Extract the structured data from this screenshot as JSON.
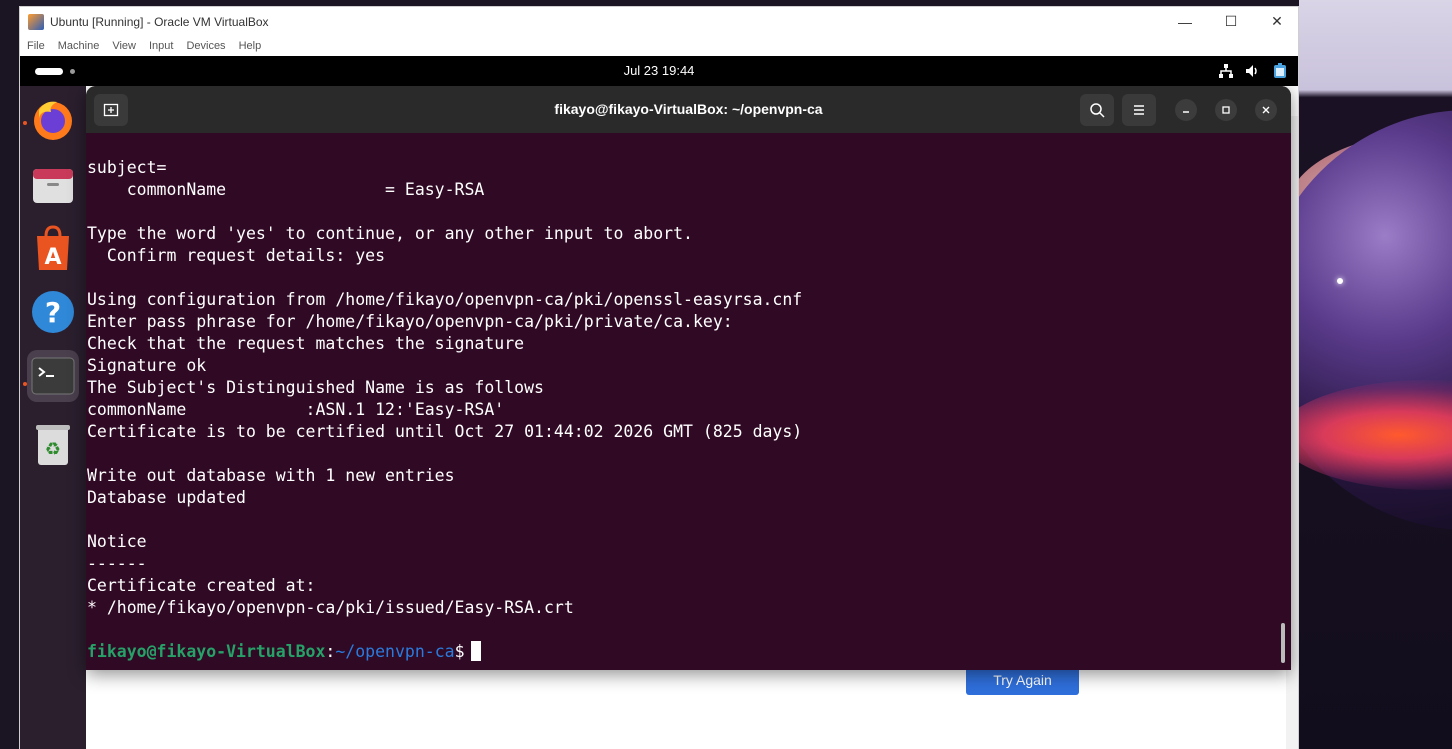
{
  "host": {
    "window_title": "Ubuntu [Running] - Oracle VM VirtualBox",
    "menu": [
      "File",
      "Machine",
      "View",
      "Input",
      "Devices",
      "Help"
    ],
    "controls": {
      "minimize": "—",
      "maximize": "☐",
      "close": "✕"
    }
  },
  "guest": {
    "clock": "Jul 23  19:44",
    "tray_icons": [
      "network-icon",
      "volume-icon",
      "battery-icon"
    ]
  },
  "dock": {
    "items": [
      {
        "name": "firefox",
        "icon": "firefox-icon"
      },
      {
        "name": "files",
        "icon": "files-icon"
      },
      {
        "name": "app-center",
        "icon": "app-center-icon"
      },
      {
        "name": "help",
        "icon": "help-icon"
      },
      {
        "name": "terminal",
        "icon": "terminal-icon"
      },
      {
        "name": "trash",
        "icon": "trash-icon"
      }
    ]
  },
  "background_page": {
    "try_again_label": "Try Again"
  },
  "terminal": {
    "title": "fikayo@fikayo-VirtualBox: ~/openvpn-ca",
    "lines": [
      "subject=",
      "    commonName                = Easy-RSA",
      "",
      "Type the word 'yes' to continue, or any other input to abort.",
      "  Confirm request details: yes",
      "",
      "Using configuration from /home/fikayo/openvpn-ca/pki/openssl-easyrsa.cnf",
      "Enter pass phrase for /home/fikayo/openvpn-ca/pki/private/ca.key:",
      "Check that the request matches the signature",
      "Signature ok",
      "The Subject's Distinguished Name is as follows",
      "commonName            :ASN.1 12:'Easy-RSA'",
      "Certificate is to be certified until Oct 27 01:44:02 2026 GMT (825 days)",
      "",
      "Write out database with 1 new entries",
      "Database updated",
      "",
      "Notice",
      "------",
      "Certificate created at:",
      "* /home/fikayo/openvpn-ca/pki/issued/Easy-RSA.crt",
      ""
    ],
    "prompt_user": "fikayo@fikayo-VirtualBox",
    "prompt_colon": ":",
    "prompt_path": "~/openvpn-ca",
    "prompt_symbol": "$"
  }
}
